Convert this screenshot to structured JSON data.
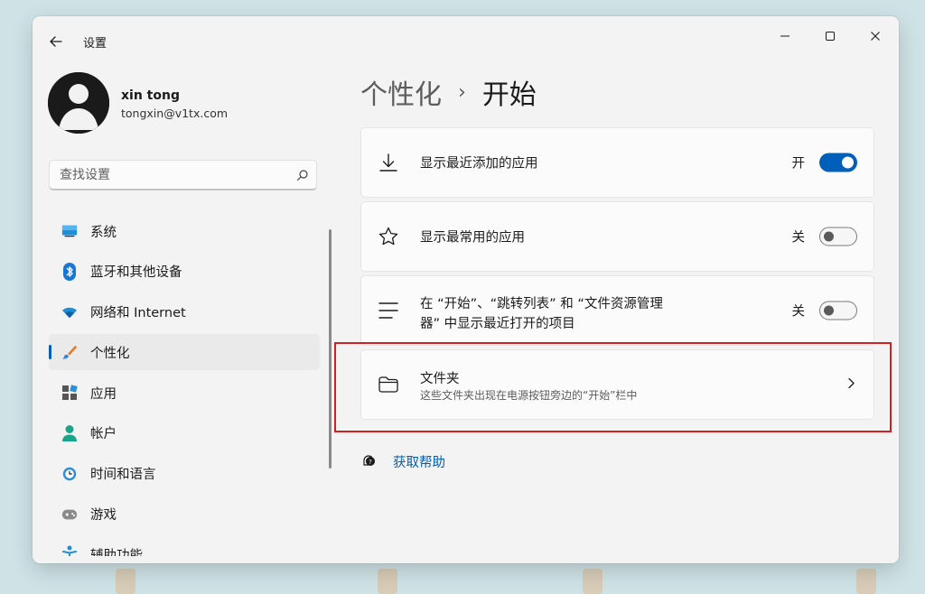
{
  "window": {
    "title": "设置"
  },
  "account": {
    "name": "xin tong",
    "email": "tongxin@v1tx.com"
  },
  "search": {
    "placeholder": "查找设置"
  },
  "nav": {
    "items": [
      {
        "label": "系统",
        "icon": "monitor-icon",
        "active": false
      },
      {
        "label": "蓝牙和其他设备",
        "icon": "bluetooth-icon",
        "active": false
      },
      {
        "label": "网络和 Internet",
        "icon": "wifi-icon",
        "active": false
      },
      {
        "label": "个性化",
        "icon": "paintbrush-icon",
        "active": true
      },
      {
        "label": "应用",
        "icon": "apps-icon",
        "active": false
      },
      {
        "label": "帐户",
        "icon": "person-icon",
        "active": false
      },
      {
        "label": "时间和语言",
        "icon": "globe-clock-icon",
        "active": false
      },
      {
        "label": "游戏",
        "icon": "gamepad-icon",
        "active": false
      },
      {
        "label": "辅助功能",
        "icon": "accessibility-icon",
        "active": false
      }
    ]
  },
  "breadcrumb": {
    "parent": "个性化",
    "separator": "›",
    "current": "开始"
  },
  "settings": [
    {
      "title": "显示最近添加的应用",
      "state": "开",
      "on": true,
      "icon": "download-icon"
    },
    {
      "title": "显示最常用的应用",
      "state": "关",
      "on": false,
      "icon": "star-icon"
    },
    {
      "title_line1": "在 “开始”、“跳转列表” 和 “文件资源管理",
      "title_line2": "器” 中显示最近打开的项目",
      "state": "关",
      "on": false,
      "icon": "list-icon"
    },
    {
      "title": "文件夹",
      "subtitle": "这些文件夹出现在电源按钮旁边的“开始”栏中",
      "icon": "folder-icon"
    }
  ],
  "help": {
    "label": "获取帮助"
  },
  "colors": {
    "accent": "#005fb8",
    "highlight": "#d22020"
  }
}
